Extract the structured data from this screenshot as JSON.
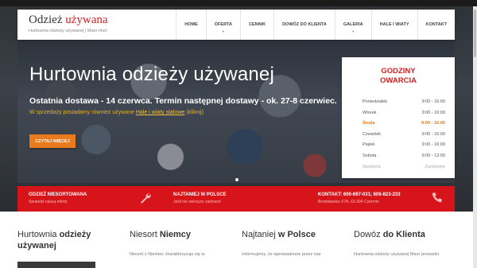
{
  "header": {
    "logo_main": "Odzież ",
    "logo_accent": "używana",
    "tagline": "Hurtownia odzieży używanej | Maor-Hurt"
  },
  "nav": {
    "items": [
      {
        "label": "HOME",
        "caret": ""
      },
      {
        "label": "OFERTA",
        "caret": "▼"
      },
      {
        "label": "CENNIK",
        "caret": ""
      },
      {
        "label": "DOWÓZ DO KLIENTA",
        "caret": ""
      },
      {
        "label": "GALERIA",
        "caret": "▼"
      },
      {
        "label": "HALE I WIATY",
        "caret": ""
      },
      {
        "label": "KONTAKT",
        "caret": ""
      }
    ]
  },
  "hero": {
    "title": "Hurtownia odzieży używanej",
    "subtitle": "Ostatnia dostawa - 14 czerwca. Termin następnej dostawy - ok. 27-8 czerwiec.",
    "promo_prefix": "W sprzedaży posiadamy również używane ",
    "promo_link": "Hale i wiaty stalowe",
    "promo_suffix": " (kliknij)",
    "button": "CZYTAJ WIĘCEJ"
  },
  "hours": {
    "title_line1": "GODZINY",
    "title_line2": "OWARCIA",
    "rows": [
      {
        "day": "Poniedziałek",
        "time": "9:00 - 16:00"
      },
      {
        "day": "Wtorek",
        "time": "9:00 - 16:00"
      },
      {
        "day": "Środa",
        "time": "9:00 - 16:00"
      },
      {
        "day": "Czwartek",
        "time": "9:00 - 16:00"
      },
      {
        "day": "Piątek",
        "time": "9:00 - 16:00"
      },
      {
        "day": "Sobota",
        "time": "9:00 - 13:00"
      },
      {
        "day": "Niedziela",
        "time": "Zamknięte"
      }
    ]
  },
  "band": {
    "c1_head": "ODZIEŻ NIESORTOWANA",
    "c1_sub": "Sprawdź naszą ofertę",
    "c2_head": "NAJTANIEJ W POLSCE",
    "c2_sub": "Jeśli nie wierzysz zadzwoń",
    "c3_head": "KONTAKT: 600-697-031; 606-823-233",
    "c3_sub": "Bronisławice 67A, 63-304 Czermin"
  },
  "content": {
    "c1_title_a": "Hurtownia ",
    "c1_title_b": "odzieży",
    "c1_title_c": "używanej",
    "c2_title_a": "Niesort ",
    "c2_title_b": "Niemcy",
    "c2_text": "Niesort z Niemiec charakteryzuje się w",
    "c3_title_a": "Najtaniej ",
    "c3_title_b": "w Polsce",
    "c3_text": "Informujemy, że wprowadzone przez nas",
    "c4_title_a": "Dowóz ",
    "c4_title_b": "do Klienta",
    "c4_text": "Hurtownia odzieży używanej Maor prowadzi"
  }
}
